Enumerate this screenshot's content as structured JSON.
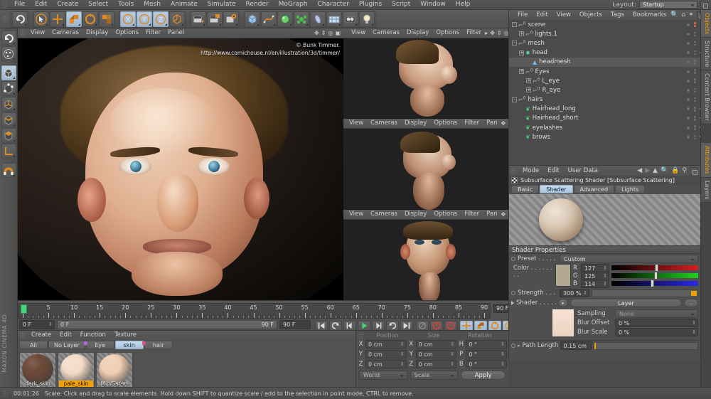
{
  "app": {
    "brand": "MAXON CINEMA 4D"
  },
  "menu": {
    "items": [
      "File",
      "Edit",
      "Create",
      "Select",
      "Tools",
      "Mesh",
      "Animate",
      "Simulate",
      "Render",
      "MoGraph",
      "Character",
      "Plugins",
      "Script",
      "Window",
      "Help"
    ],
    "layout_label": "Layout:",
    "layout_value": "Startup"
  },
  "toolbar": {
    "groups": [
      {
        "name": "undo",
        "items": [
          {
            "icon": "undo-icon",
            "active": false
          }
        ]
      },
      {
        "name": "modes",
        "items": [
          {
            "icon": "select-cursor-icon",
            "active": false
          },
          {
            "icon": "move-icon",
            "active": false
          },
          {
            "icon": "scale-icon",
            "active": true
          },
          {
            "icon": "rotate-icon",
            "active": false
          },
          {
            "icon": "tool-variant-icon",
            "active": false
          }
        ]
      },
      {
        "name": "axis-locks",
        "items": [
          {
            "icon": "x-axis-icon",
            "active": true
          },
          {
            "icon": "y-axis-icon",
            "active": true
          },
          {
            "icon": "z-axis-icon",
            "active": true
          },
          {
            "icon": "world-axis-icon",
            "active": false
          }
        ]
      },
      {
        "name": "render",
        "items": [
          {
            "icon": "render-view-icon",
            "active": false
          },
          {
            "icon": "render-region-icon",
            "active": false
          },
          {
            "icon": "render-settings-icon",
            "active": false
          }
        ]
      },
      {
        "name": "primitives",
        "items": [
          {
            "icon": "cube-primitive-icon",
            "active": false
          },
          {
            "icon": "spline-icon",
            "active": false
          },
          {
            "icon": "nurbs-icon",
            "active": false
          },
          {
            "icon": "array-icon",
            "active": false
          },
          {
            "icon": "deformer-icon",
            "active": false
          },
          {
            "icon": "environment-icon",
            "active": false
          },
          {
            "icon": "camera-icon",
            "active": false
          },
          {
            "icon": "light-icon",
            "active": false
          }
        ]
      }
    ]
  },
  "left_toolbar": {
    "items": [
      {
        "icon": "undo-tool-icon",
        "active": false
      },
      {
        "icon": "live-selection-icon",
        "active": false
      },
      {
        "icon": "model-mode-icon",
        "active": true
      },
      {
        "icon": "point-mode-icon",
        "active": false
      },
      {
        "icon": "object-axis-icon",
        "active": false
      },
      {
        "icon": "edge-mode-icon",
        "active": false
      },
      {
        "icon": "polygon-mode-icon",
        "active": false
      },
      {
        "icon": "axis-mode-icon",
        "active": false
      },
      {
        "icon": "magnet-icon",
        "active": false
      }
    ]
  },
  "viewports": {
    "main": {
      "menu": [
        "View",
        "Cameras",
        "Display",
        "Options",
        "Filter",
        "Panel"
      ],
      "watermark_line1": "© Bunk Timmer.",
      "watermark_line2": "http://www.comichouse.nl/en/illustration/3d/timmer/"
    },
    "top_right": {
      "menu": [
        "View",
        "Cameras",
        "Display",
        "Options",
        "Filter"
      ]
    },
    "mid_right": {
      "menu": [
        "View",
        "Cameras",
        "Display",
        "Options",
        "Filter",
        "Pan"
      ]
    },
    "bottom_right": {
      "menu": [
        "View",
        "Cameras",
        "Display",
        "Options",
        "Filter",
        "Pan"
      ]
    }
  },
  "timeline": {
    "ticks": [
      0,
      5,
      10,
      15,
      20,
      25,
      30,
      35,
      40,
      45,
      50,
      55,
      60,
      65,
      70,
      75,
      80,
      85,
      90
    ],
    "current_frame": "0 F",
    "range_start": "0 F",
    "range_end": "90 F",
    "doc_end": "90 F",
    "preview_end": "90 F",
    "playhead_frame": 0,
    "transport": [
      {
        "icon": "goto-start-icon",
        "active": false
      },
      {
        "icon": "play-backward-loop-icon",
        "active": false
      },
      {
        "icon": "step-back-icon",
        "active": false
      },
      {
        "icon": "play-icon",
        "active": false
      },
      {
        "icon": "step-forward-icon",
        "active": false
      },
      {
        "icon": "loop-icon",
        "active": false
      },
      {
        "icon": "goto-end-icon",
        "active": false
      },
      {
        "icon": "record-active-objects-icon",
        "active": false
      },
      {
        "icon": "autokey-icon",
        "active": false
      },
      {
        "icon": "keyframe-selection-icon",
        "active": false
      },
      {
        "icon": "position-key-icon",
        "active": true
      },
      {
        "icon": "scale-key-icon",
        "active": true
      },
      {
        "icon": "rotation-key-icon",
        "active": true
      },
      {
        "icon": "param-key-icon",
        "active": true
      },
      {
        "icon": "point-level-anim-icon",
        "active": true
      },
      {
        "icon": "timeline-icon",
        "active": true
      }
    ]
  },
  "material_manager": {
    "menu": [
      "Create",
      "Edit",
      "Function",
      "Texture"
    ],
    "layers": [
      {
        "label": "All",
        "selected": false,
        "flag": ""
      },
      {
        "label": "No Layer",
        "selected": false,
        "flag": ""
      },
      {
        "label": "Eye",
        "selected": false,
        "flag": "#b06ad8"
      },
      {
        "label": "skin",
        "selected": true,
        "flag": ""
      },
      {
        "label": "hair",
        "selected": false,
        "flag": "#e0508a"
      }
    ],
    "materials": [
      {
        "name": "dark_skin",
        "selected": false,
        "color": "#6d4a38"
      },
      {
        "name": "pale_skin",
        "selected": true,
        "color": "#f4ddc8"
      },
      {
        "name": "Mip/Sat-vs",
        "selected": false,
        "color": "#f0cfb5"
      }
    ]
  },
  "coordinates": {
    "col_headers": [
      "Position",
      "Size",
      "Rotation"
    ],
    "rows": [
      {
        "l1": "X",
        "v1": "0 cm",
        "l2": "X",
        "v2": "0 cm",
        "l3": "H",
        "v3": "0 °"
      },
      {
        "l1": "Y",
        "v1": "0 cm",
        "l2": "Y",
        "v2": "0 cm",
        "l3": "P",
        "v3": "0 °"
      },
      {
        "l1": "Z",
        "v1": "0 cm",
        "l2": "Z",
        "v2": "0 cm",
        "l3": "B",
        "v3": "0 °"
      }
    ],
    "system": "World",
    "mode": "Scale",
    "apply": "Apply"
  },
  "object_manager": {
    "menu": [
      "File",
      "Edit",
      "View",
      "Objects",
      "Tags",
      "Bookmarks"
    ],
    "rows": [
      {
        "name": "scene",
        "indent": 0,
        "icon": "null-object-icon",
        "expander": "-",
        "visible_red": true,
        "check": false,
        "tags": []
      },
      {
        "name": "lights.1",
        "indent": 1,
        "icon": "null-object-icon",
        "expander": "+",
        "visible_red": false,
        "check": false,
        "tags": []
      },
      {
        "name": "mesh",
        "indent": 0,
        "icon": "null-object-icon",
        "expander": "-",
        "visible_red": false,
        "check": false,
        "tags": []
      },
      {
        "name": "head",
        "indent": 1,
        "icon": "hypernurbs-icon",
        "expander": "+",
        "visible_red": false,
        "check": true,
        "tags": []
      },
      {
        "name": "headmesh",
        "indent": 2,
        "icon": "polygon-object-icon",
        "expander": "",
        "visible_red": false,
        "check": false,
        "selected": true,
        "tags": [
          "tri",
          "tri",
          "tri",
          "ball",
          "checker",
          "dots"
        ]
      },
      {
        "name": "Eyes",
        "indent": 1,
        "icon": "null-object-icon",
        "expander": "+",
        "visible_red": false,
        "check": false,
        "tags": []
      },
      {
        "name": "L_eye",
        "indent": 2,
        "icon": "null-object-icon",
        "expander": "+",
        "visible_red": false,
        "check": false,
        "tags": []
      },
      {
        "name": "R_eye",
        "indent": 2,
        "icon": "null-object-icon",
        "expander": "+",
        "visible_red": false,
        "check": false,
        "tags": []
      },
      {
        "name": "hairs",
        "indent": 0,
        "icon": "null-object-icon",
        "expander": "-",
        "visible_red": false,
        "check": false,
        "tags": []
      },
      {
        "name": "Hairhead_long",
        "indent": 1,
        "icon": "hair-object-icon",
        "expander": "",
        "visible_red": false,
        "check": true,
        "tags": [
          "hatch",
          "dots"
        ]
      },
      {
        "name": "Hairhead_short",
        "indent": 1,
        "icon": "hair-object-icon",
        "expander": "",
        "visible_red": false,
        "check": true,
        "tags": [
          "hatch",
          "dots"
        ]
      },
      {
        "name": "eyelashes",
        "indent": 1,
        "icon": "hair-object-icon",
        "expander": "",
        "visible_red": false,
        "check": true,
        "tags": [
          "hatch",
          "dots"
        ]
      },
      {
        "name": "brows",
        "indent": 1,
        "icon": "hair-object-icon",
        "expander": "",
        "visible_red": false,
        "check": true,
        "tags": [
          "hatch",
          "dots"
        ]
      }
    ]
  },
  "attributes": {
    "menu": [
      "Mode",
      "Edit",
      "User Data"
    ],
    "title": "Subsurface Scattering Shader [Subsurface Scattering]",
    "tabs": [
      {
        "label": "Basic",
        "selected": false
      },
      {
        "label": "Shader",
        "selected": true
      },
      {
        "label": "Advanced",
        "selected": false
      },
      {
        "label": "Lights",
        "selected": false
      }
    ],
    "section_title": "Shader Properties",
    "preset_label": "Preset . . . . . . . .",
    "preset_value": "Custom",
    "color_label": "Color . . . . . . . .",
    "color_swatch": "#b2a894",
    "channels": [
      {
        "label": "R",
        "value": "127",
        "bar": "#d81e1e",
        "pos": 50
      },
      {
        "label": "G",
        "value": "125",
        "bar": "#1fd41f",
        "pos": 49
      },
      {
        "label": "B",
        "value": "114",
        "bar": "#2929e6",
        "pos": 45
      }
    ],
    "strength_label": "Strength . . . . . .",
    "strength_value": "300 %",
    "shader_label": "Shader . . . . . . .",
    "shader_value": "Layer",
    "shader_more": "...",
    "sampling_label": "Sampling",
    "sampling_value": "None",
    "blur_offset_label": "Blur Offset",
    "blur_offset_value": "0 %",
    "blur_scale_label": "Blur Scale",
    "blur_scale_value": "0 %",
    "path_length_label": "Path Length",
    "path_length_value": "0.15 cm"
  },
  "right_tabs": {
    "top": [
      {
        "label": "Objects",
        "selected": true
      },
      {
        "label": "Structure",
        "selected": false
      },
      {
        "label": "Content Browser",
        "selected": false
      }
    ],
    "bottom": [
      {
        "label": "Attributes",
        "selected": true
      },
      {
        "label": "Layers",
        "selected": false
      }
    ]
  },
  "status": {
    "time": "00:01:26",
    "message": "Scale: Click and drag to scale elements. Hold down SHIFT to quantize scale / add to the selection in point mode, CTRL to remove."
  },
  "colors": {
    "accent": "#f0a000",
    "selection": "#a8c3dc",
    "green_check": "#55d07a",
    "panel": "#4f4f4f"
  }
}
